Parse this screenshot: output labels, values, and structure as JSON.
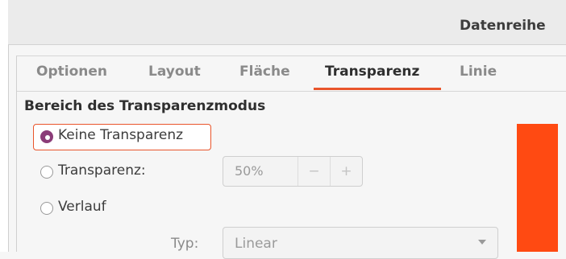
{
  "window": {
    "title": "Datenreihe"
  },
  "tabs": [
    {
      "label": "Optionen",
      "active": false
    },
    {
      "label": "Layout",
      "active": false
    },
    {
      "label": "Fläche",
      "active": false
    },
    {
      "label": "Transparenz",
      "active": true
    },
    {
      "label": "Linie",
      "active": false
    }
  ],
  "section": {
    "title": "Bereich des Transparenzmodus"
  },
  "options": {
    "none": {
      "label": "Keine Transparenz",
      "selected": true
    },
    "transparency": {
      "label": "Transparenz:",
      "selected": false,
      "value": "50%",
      "minus": "−",
      "plus": "+"
    },
    "gradient": {
      "label": "Verlauf",
      "selected": false
    }
  },
  "gradient": {
    "type_label": "Typ:",
    "type_value": "Linear"
  },
  "colors": {
    "accent": "#e9552b",
    "radio_selected": "#8b3c78",
    "preview": "#ff4a12"
  }
}
